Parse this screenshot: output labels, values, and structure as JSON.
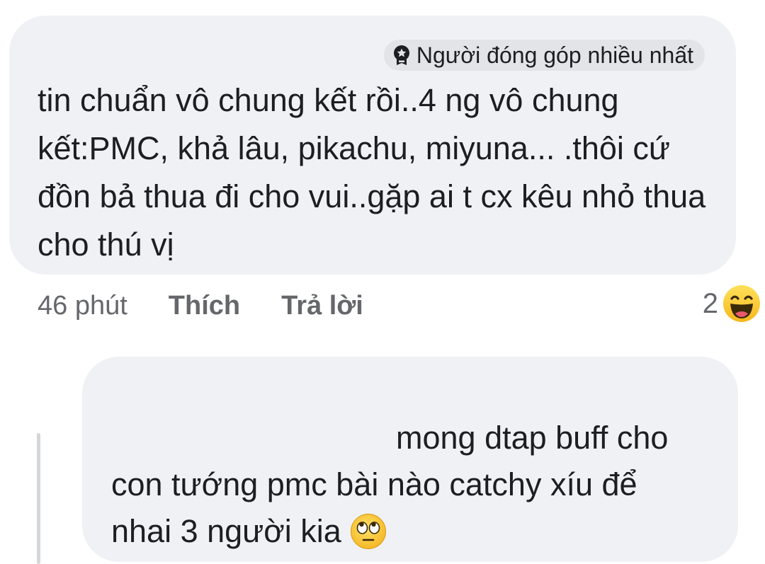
{
  "comment": {
    "badge_label": "Người đóng góp nhiều nhất",
    "badge_icon": "top-contributor-badge-icon",
    "text": "tin chuẩn vô chung kết rồi..4 ng vô chung kết:PMC, khả lâu, pikachu, miyuna... .thôi cứ đồn bả thua đi cho vui..gặp ai t cx kêu nhỏ thua cho thú vị",
    "time": "46 phút",
    "like_label": "Thích",
    "reply_label": "Trả lời",
    "reaction_count": "2",
    "reaction_icon": "haha-emoji-icon"
  },
  "reply": {
    "line1": "mong dtap buff cho",
    "line2": "con tướng pmc bài nào catchy xíu để",
    "line3": "nhai 3 người kia",
    "emoji": "rolling-eyes-emoji-icon"
  },
  "colors": {
    "bubble_bg": "#f0f1f5",
    "badge_bg": "#e3e4e8",
    "text": "#1c1e21",
    "secondary_text": "#65676b",
    "thread_line": "#d5d6da"
  }
}
